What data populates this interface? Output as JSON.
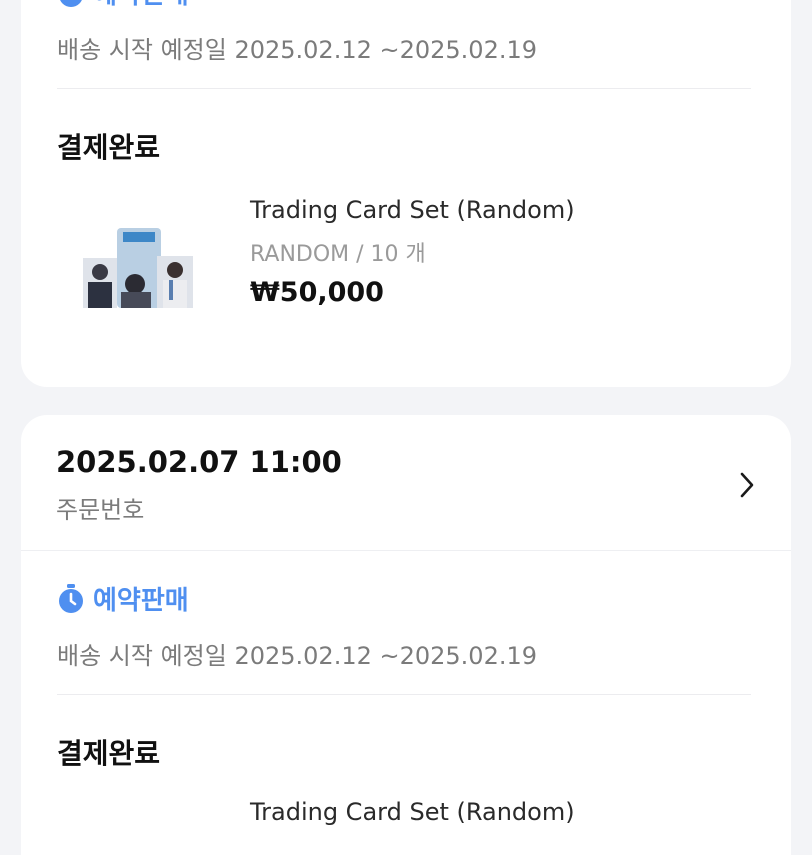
{
  "orders": [
    {
      "badge": "예약판매",
      "shipping": "배송 시작 예정일 2025.02.12 ~2025.02.19",
      "status": "결제완료",
      "product": {
        "name": "Trading Card Set (Random)",
        "option": "RANDOM / 10 개",
        "price": "₩50,000"
      }
    },
    {
      "date": "2025.02.07 11:00",
      "order_number_label": "주문번호",
      "badge": "예약판매",
      "shipping": "배송 시작 예정일 2025.02.12 ~2025.02.19",
      "status": "결제완료",
      "product": {
        "name": "Trading Card Set (Random)"
      }
    }
  ],
  "icons": {
    "badge": "stopwatch-icon",
    "detail": "chevron-right-icon"
  },
  "colors": {
    "accent": "#4f8ff0",
    "background": "#f3f4f7",
    "card": "#ffffff"
  }
}
